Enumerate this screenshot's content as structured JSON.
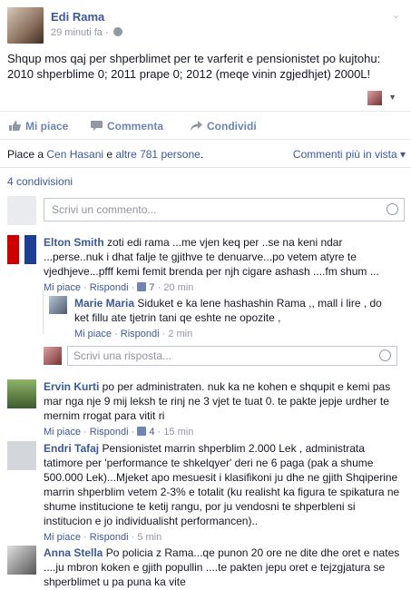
{
  "post": {
    "author": "Edi Rama",
    "time": "29 minuti fa · ",
    "text": "Shqup mos qaj per shperblimet per te varferit e pensionistet po kujtohu: 2010 shperblime 0; 2011 prape 0; 2012 (meqe vinin zgjedhjet) 2000L!"
  },
  "actions": {
    "like": "Mi piace",
    "comment": "Commenta",
    "share": "Condividi"
  },
  "summary": {
    "prefix": "Piace a ",
    "first_liker": "Cen Hasani",
    "middle": " e ",
    "others": "altre 781 persone",
    "suffix": ".",
    "sort": "Commenti più in vista ▾"
  },
  "shares": "4 condivisioni",
  "composer_placeholder": "Scrivi un commento...",
  "reply_placeholder": "Scrivi una risposta...",
  "comments": [
    {
      "name": "Elton Smith",
      "text": " zoti edi rama ...me vjen keq per ..se na keni ndar ...perse..nuk i dhat falje te gjithve te denuarve...po vetem atyre te vjedhjeve...pfff kemi femit brenda per njh cigare ashash ....fm shum ...",
      "like": "Mi piace",
      "reply": "Rispondi",
      "likes": "7",
      "time": "20 min"
    },
    {
      "name": "Marie Maria",
      "text": " Siduket e ka lene hashashin Rama ,, mall i lire , do ket fillu ate tjetrin tani qe eshte ne opozite ,",
      "like": "Mi piace",
      "reply": "Rispondi",
      "time": "2 min"
    },
    {
      "name": "Ervin Kurti",
      "text": " po per administraten. nuk ka ne kohen e shqupit e kemi pas mar nga nje 9 mij leksh te rinj ne 3 vjet te tuat 0. te pakte jepje urdher te mernim rrogat para vitit ri",
      "like": "Mi piace",
      "reply": "Rispondi",
      "likes": "4",
      "time": "15 min"
    },
    {
      "name": "Endri Tafaj",
      "text": " Pensionistet marrin shperblim 2.000 Lek , administrata tatimore per 'performance te shkelqyer' deri ne 6 paga (pak a shume 500.000 Lek)...Mjeket apo mesuesit i klasifikoni ju dhe ne gjith Shqiperine marrin shperblim vetem 2-3% e totalit (ku realisht ka figura te spikatura ne shume institucione te ketij rangu, por ju vendosni te shperbleni si institucion e jo individualisht performancen)..",
      "like": "Mi piace",
      "reply": "Rispondi",
      "time": "5 min"
    },
    {
      "name": "Anna Stella",
      "text": " Po policia z Rama...qe punon 20 ore ne dite dhe oret e nates ....ju mbron koken e gjith popullin ....te pakten jepu oret e tejzgjatura se shperblimet u pa puna ka vite"
    }
  ],
  "colors": {
    "link": "#3b5998",
    "muted": "#9197a3",
    "action": "#6d84b4",
    "border": "#e5e5e5"
  }
}
